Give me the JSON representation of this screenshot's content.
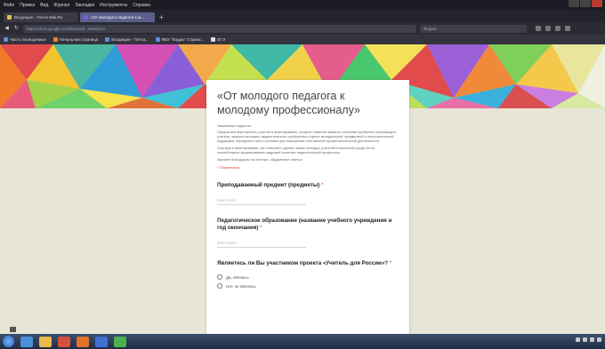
{
  "browser": {
    "menu": [
      "Файл",
      "Правка",
      "Вид",
      "Журнал",
      "Закладки",
      "Инструменты",
      "Справка"
    ],
    "tabs": [
      {
        "label": "Входящие - Почта Mail.Ru",
        "active": false
      },
      {
        "label": "«От молодого педагога к м...",
        "active": true
      }
    ],
    "url": "https://docs.google.com/forms/d/.../viewform",
    "search_placeholder": "Яндекс",
    "bookmarks": [
      "Часто посещаемые",
      "Начальная страница",
      "Входящие - Почта...",
      "ФБУ \"Кадры\" Страна...",
      "ЕГЭ"
    ]
  },
  "form": {
    "title": "«От молодого педагога к молодому профессионалу»",
    "description_heading": "Уважаемые педагоги!",
    "description_paragraphs": [
      "Предлагаем Вам принять участие в анкетировании, которое позволит выявить основные проблемы начинающего учителя, запросы молодого педагогического сообщества к сфере методической, предметной и психологической поддержки, определить пути и условия для повышения собственной профессиональной деятельности.",
      "Участвуя в анкетировании, вы помогаете сделать жизнь молодых учителей в школьной среде легче, способствуете формированию кадровой политики педагогической профессии.",
      "Заранее благодарим за честные, обдуманные ответы!"
    ],
    "required_note": "* Обязательно",
    "questions": [
      {
        "label": "Преподаваемый предмет (предметы)",
        "type": "text",
        "placeholder": "Мой ответ",
        "required": true
      },
      {
        "label": "Педагогическое образование (название учебного учреждения и год окончания)",
        "type": "text",
        "placeholder": "Мой ответ",
        "required": true
      },
      {
        "label": "Являетесь ли Вы участником проекта «Учитель для России»?",
        "type": "radio",
        "options": [
          "Да, являюсь",
          "Нет, не являюсь"
        ],
        "required": true
      }
    ],
    "required_marker": "*"
  },
  "colors": {
    "card_bg": "#ffffff",
    "page_bg": "#e7e5d6",
    "required": "#d33333",
    "title": "#444444"
  },
  "icons": [
    "chat-icon",
    "start-orb-icon",
    "firefox-icon",
    "folder-icon",
    "mail-icon"
  ]
}
